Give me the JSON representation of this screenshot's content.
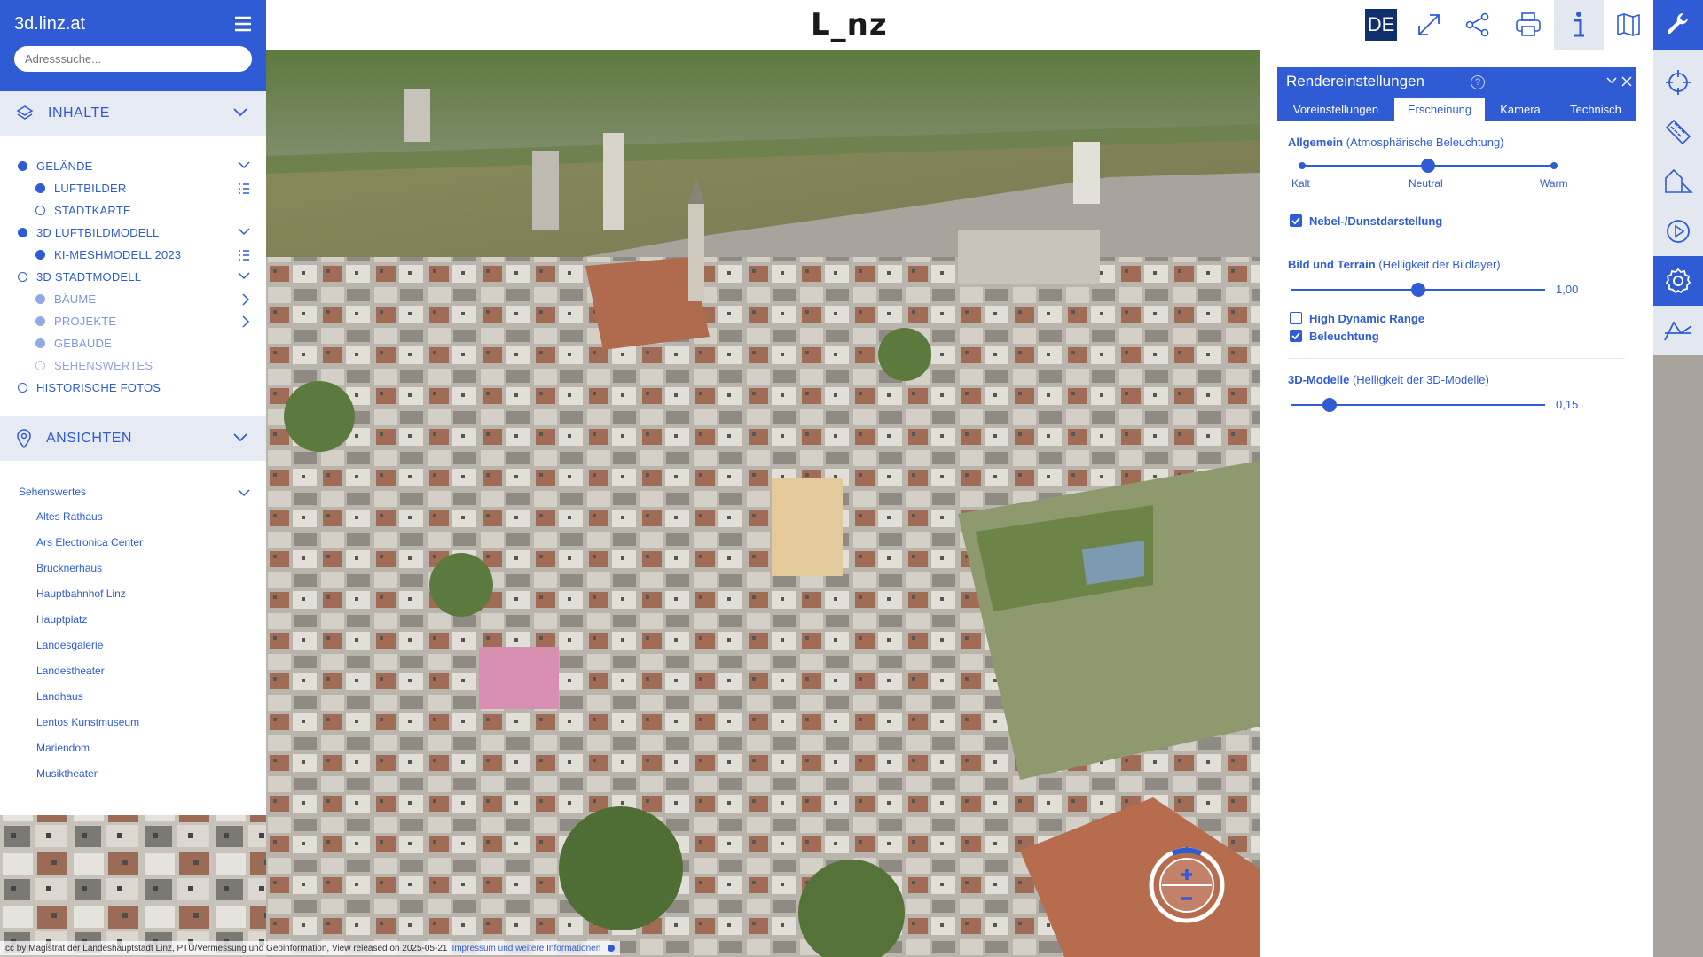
{
  "app": {
    "title": "3d.linz.at",
    "logo": "L_nz",
    "search_placeholder": "Adresssuche..."
  },
  "toolbar": {
    "lang": "DE",
    "buttons": [
      "fullscreen-icon",
      "share-icon",
      "print-icon",
      "info-icon",
      "map-book-icon",
      "wrench-icon"
    ]
  },
  "sidebar": {
    "inhalte_label": "INHALTE",
    "layers": [
      {
        "label": "GELÄNDE",
        "active": true
      },
      {
        "label": "LUFTBILDER",
        "active": true
      },
      {
        "label": "STADTKARTE",
        "active": false
      },
      {
        "label": "3D LUFTBILDMODELL",
        "active": true
      },
      {
        "label": "KI-MESHMODELL 2023",
        "active": true
      },
      {
        "label": "3D STADTMODELL",
        "active": false
      },
      {
        "label": "BÄUME",
        "active": true
      },
      {
        "label": "PROJEKTE",
        "active": true
      },
      {
        "label": "GEBÄUDE",
        "active": true
      },
      {
        "label": "SEHENSWERTES",
        "active": false
      },
      {
        "label": "HISTORISCHE FOTOS",
        "active": false
      }
    ],
    "ansichten_label": "ANSICHTEN",
    "view_group": "Sehenswertes",
    "views": [
      "Altes Rathaus",
      "Ars Electronica Center",
      "Brucknerhaus",
      "Hauptbahnhof Linz",
      "Hauptplatz",
      "Landesgalerie",
      "Landestheater",
      "Landhaus",
      "Lentos Kunstmuseum",
      "Mariendom",
      "Musiktheater"
    ]
  },
  "rail": {
    "buttons": [
      "crosshair-icon",
      "ruler-icon",
      "shadow-icon",
      "play-icon",
      "settings-icon",
      "profile-icon"
    ],
    "active": "settings-icon"
  },
  "panel": {
    "title": "Rendereinstellungen",
    "help": "?",
    "tabs": [
      "Voreinstellungen",
      "Erscheinung",
      "Kamera",
      "Technisch"
    ],
    "active_tab": "Erscheinung",
    "general": {
      "title": "Allgemein",
      "subtitle": "(Atmosphärische Beleuchtung)",
      "options": [
        "Kalt",
        "Neutral",
        "Warm"
      ],
      "selected": "Neutral"
    },
    "fog": {
      "label": "Nebel-/Dunstdarstellung",
      "checked": true
    },
    "terrain": {
      "title": "Bild und Terrain",
      "subtitle": "(Helligkeit der Bildlayer)",
      "value": "1,00",
      "fraction": 0.5
    },
    "hdr": {
      "label": "High Dynamic Range",
      "checked": false
    },
    "lighting": {
      "label": "Beleuchtung",
      "checked": true
    },
    "models": {
      "title": "3D-Modelle",
      "subtitle": "(Helligkeit der 3D-Modelle)",
      "value": "0,15",
      "fraction": 0.15
    }
  },
  "zoom": {
    "in": "+",
    "out": "−"
  },
  "attribution": {
    "text": "cc by Magistrat der Landeshauptstadt Linz, PTU/Vermessung und Geoinformation, View released on 2025-05-21",
    "link": "Impressum und weitere Informationen"
  },
  "colors": {
    "accent": "#2f5bd5",
    "dark_navy": "#102f6d",
    "section_bg": "#e6ebf3"
  }
}
